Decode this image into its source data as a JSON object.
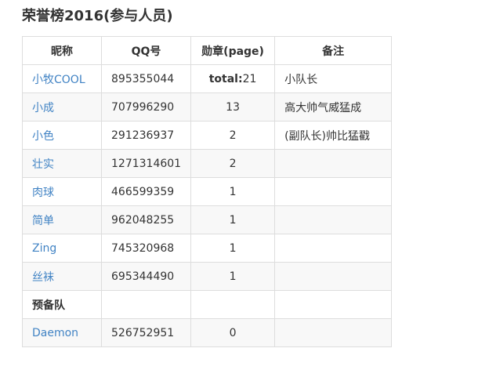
{
  "page": {
    "title": "荣誉榜2016(参与人员)"
  },
  "table": {
    "headers": {
      "nick": "昵称",
      "qq": "QQ号",
      "medal": "勋章(page)",
      "note": "备注"
    },
    "rows": [
      {
        "nick": "小牧COOL",
        "qq": "895355044",
        "medal_label": "total:",
        "medal": "21",
        "note": "小队长"
      },
      {
        "nick": "小成",
        "qq": "707996290",
        "medal": "13",
        "note": "高大帅气威猛成"
      },
      {
        "nick": "小色",
        "qq": "291236937",
        "medal": "2",
        "note": "(副队长)帅比猛戳"
      },
      {
        "nick": "壮实",
        "qq": "1271314601",
        "medal": "2",
        "note": ""
      },
      {
        "nick": "肉球",
        "qq": "466599359",
        "medal": "1",
        "note": ""
      },
      {
        "nick": "简单",
        "qq": "962048255",
        "medal": "1",
        "note": ""
      },
      {
        "nick": "Zing",
        "qq": "745320968",
        "medal": "1",
        "note": ""
      },
      {
        "nick": "丝袜",
        "qq": "695344490",
        "medal": "1",
        "note": ""
      },
      {
        "nick": "预备队",
        "qq": "",
        "medal": "",
        "note": ""
      },
      {
        "nick": "Daemon",
        "qq": "526752951",
        "medal": "0",
        "note": ""
      }
    ]
  },
  "colors": {
    "link": "#4183c4",
    "border": "#dddddd",
    "stripe": "#f8f8f8",
    "text": "#333333"
  }
}
